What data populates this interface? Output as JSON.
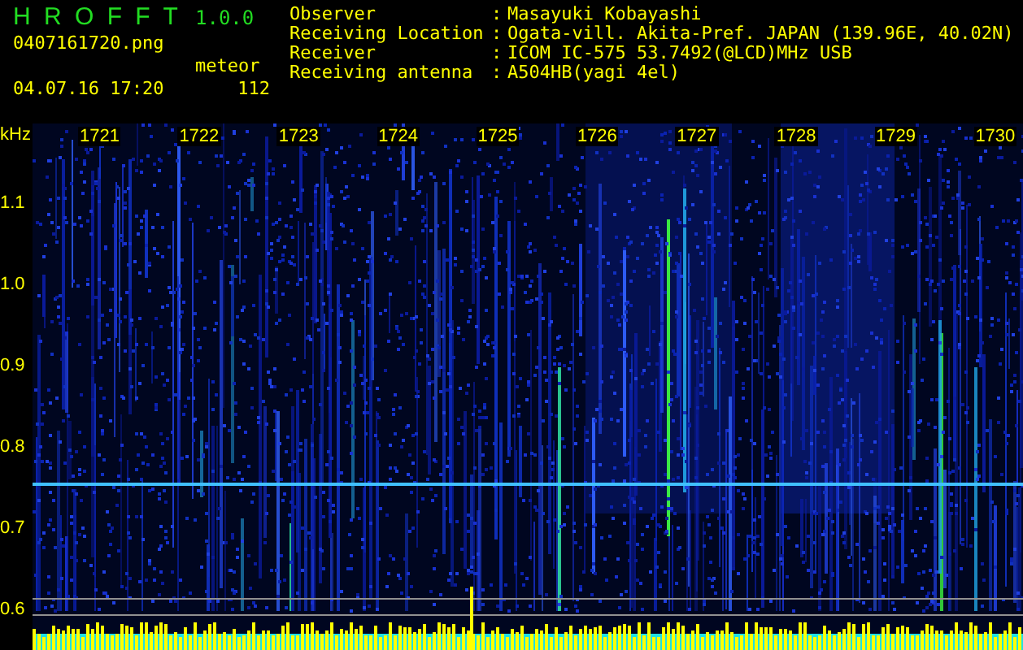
{
  "header": {
    "app_title": "H R O F F T",
    "version": "1.0.0",
    "filename": "0407161720.png",
    "datetime": "04.07.16 17:20",
    "meteor_label": "meteor",
    "meteor_count": "112"
  },
  "info": [
    {
      "label": "Observer",
      "separator": ":",
      "value": "Masayuki Kobayashi"
    },
    {
      "label": "Receiving Location",
      "separator": ":",
      "value": "Ogata-vill. Akita-Pref. JAPAN (139.96E, 40.02N)"
    },
    {
      "label": "Receiver",
      "separator": ":",
      "value": "ICOM IC-575 53.7492(@LCD)MHz USB"
    },
    {
      "label": "Receiving antenna",
      "separator": ":",
      "value": "A504HB(yagi 4el)"
    }
  ],
  "y_axis": {
    "unit": "kHz",
    "ticks": [
      "1.1",
      "1.0",
      "0.9",
      "0.8",
      "0.7",
      "0.6"
    ]
  },
  "time_labels": [
    "1721",
    "1722",
    "1723",
    "1724",
    "1725",
    "1726",
    "1727",
    "1728",
    "1729",
    "1730"
  ]
}
